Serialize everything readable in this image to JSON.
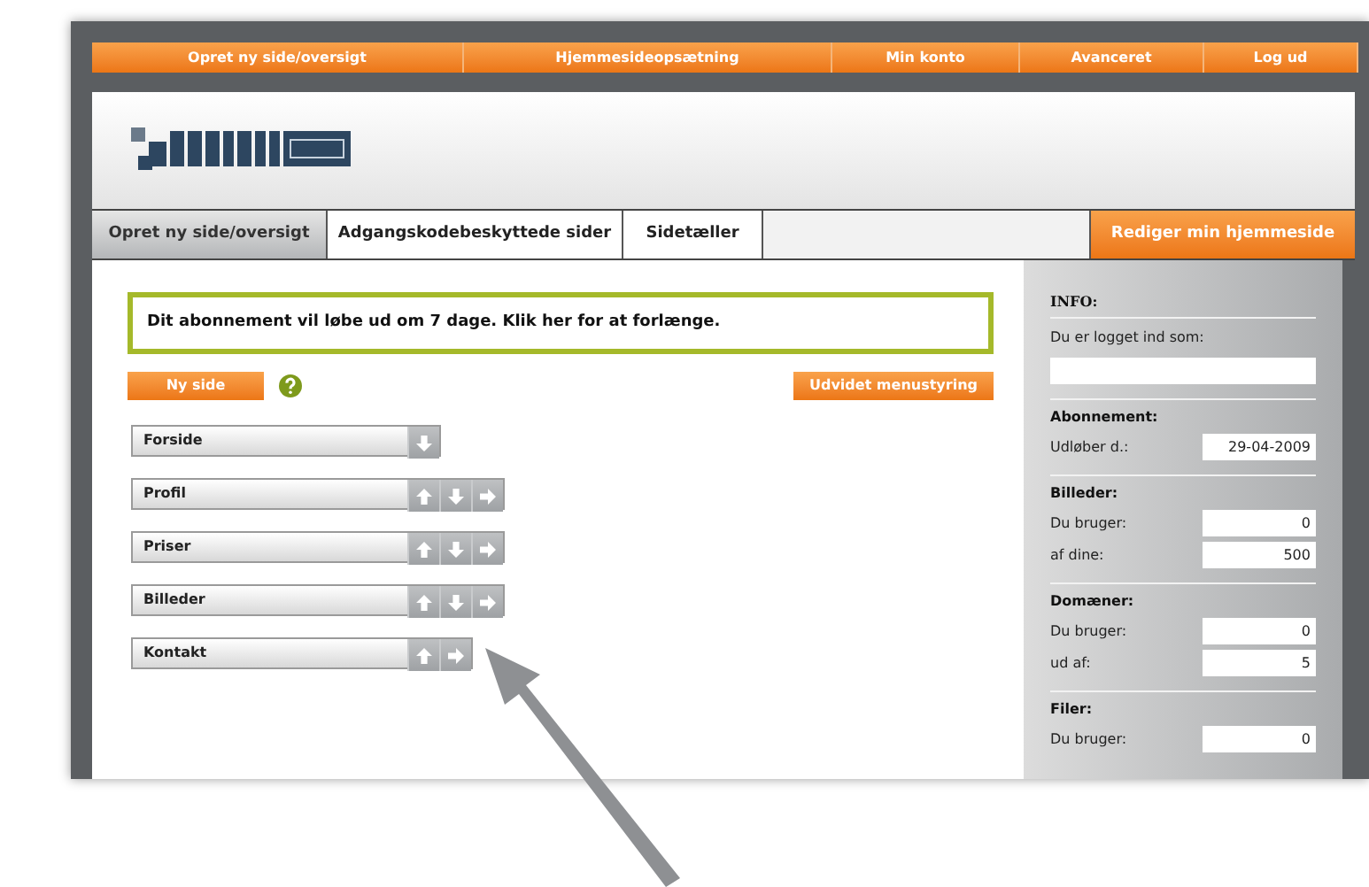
{
  "top_nav": [
    {
      "label": "Opret ny side/oversigt"
    },
    {
      "label": "Hjemmesideopsætning"
    },
    {
      "label": "Min konto"
    },
    {
      "label": "Avanceret"
    },
    {
      "label": "Log ud"
    }
  ],
  "tabs": [
    {
      "label": "Opret ny side/oversigt",
      "selected": true
    },
    {
      "label": "Adgangskodebeskyttede sider",
      "selected": false
    },
    {
      "label": "Sidetæller",
      "selected": false
    }
  ],
  "edit_button": "Rediger min hjemmeside",
  "notice": "Dit abonnement vil løbe ud om 7 dage. Klik her for at forlænge.",
  "new_page_button": "Ny side",
  "menu_button": "Udvidet menustyring",
  "pages": [
    {
      "label": "Forside",
      "arrows": [
        {
          "kind": "down"
        }
      ]
    },
    {
      "label": "Profil",
      "arrows": [
        {
          "kind": "up"
        },
        {
          "kind": "down"
        },
        {
          "kind": "right"
        }
      ]
    },
    {
      "label": "Priser",
      "arrows": [
        {
          "kind": "up"
        },
        {
          "kind": "down"
        },
        {
          "kind": "right"
        }
      ]
    },
    {
      "label": "Billeder",
      "arrows": [
        {
          "kind": "up"
        },
        {
          "kind": "down"
        },
        {
          "kind": "right"
        }
      ]
    },
    {
      "label": "Kontakt",
      "arrows": [
        {
          "kind": "up"
        },
        {
          "kind": "right"
        }
      ]
    }
  ],
  "sidebar": {
    "info_title": "INFO:",
    "logged_in_label": "Du er logget ind som:",
    "sections": [
      {
        "title": "Abonnement:",
        "rows": [
          {
            "label": "Udløber d.:",
            "value": "29-04-2009"
          }
        ]
      },
      {
        "title": "Billeder:",
        "rows": [
          {
            "label": "Du bruger:",
            "value": "0"
          },
          {
            "label": "af dine:",
            "value": "500"
          }
        ]
      },
      {
        "title": "Domæner:",
        "rows": [
          {
            "label": "Du bruger:",
            "value": "0"
          },
          {
            "label": "ud af:",
            "value": "5"
          }
        ]
      },
      {
        "title": "Filer:",
        "rows": [
          {
            "label": "Du bruger:",
            "value": "0"
          }
        ]
      }
    ]
  }
}
